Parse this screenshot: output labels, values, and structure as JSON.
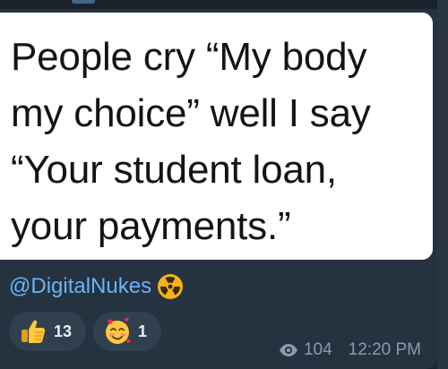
{
  "post": {
    "quote_text": "People cry “My body\nmy choice” well I say\n“Your student loan,\nyour payments.”",
    "author": "@DigitalNukes",
    "author_badge_icon": "radioactive-icon"
  },
  "reactions": [
    {
      "icon": "thumbs-up-icon",
      "count": "13"
    },
    {
      "icon": "smiling-face-with-hearts-icon",
      "count": "1"
    }
  ],
  "meta": {
    "views_icon": "eye-icon",
    "views": "104",
    "time": "12:20 PM"
  },
  "colors": {
    "background": "#1f2a36",
    "bubble": "#253240",
    "link": "#6ab3f3",
    "reaction_bg": "#30404f",
    "meta_text": "#8b9bab"
  }
}
